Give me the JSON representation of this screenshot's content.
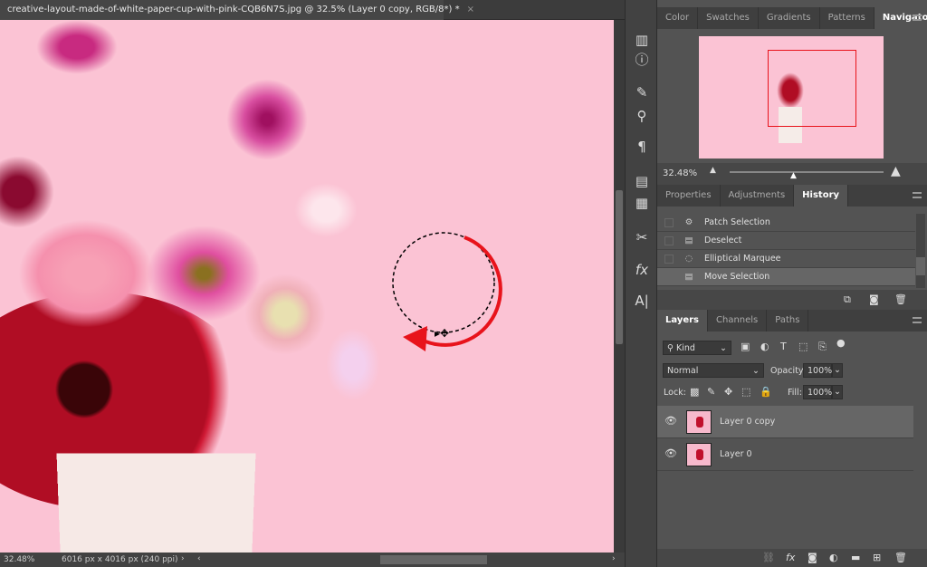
{
  "document": {
    "tab_title": "creative-layout-made-of-white-paper-cup-with-pink-CQB6N7S.jpg @ 32.5% (Layer 0 copy, RGB/8*) *",
    "close_icon": "×"
  },
  "status": {
    "zoom": "32.48%",
    "doc_info": "6016 px x 4016 px (240 ppi)",
    "arrow": "›",
    "scroll_left": "‹",
    "scroll_right": "›"
  },
  "toolstrip": [
    "history-icon",
    "info-icon",
    "brush-settings-icon",
    "clone-source-icon",
    "paragraph-icon",
    "character-styles-icon",
    "paragraph-styles-icon",
    "tool-presets-icon",
    "styles-icon",
    "glyphs-icon"
  ],
  "top_panel": {
    "tabs": [
      "Color",
      "Swatches",
      "Gradients",
      "Patterns",
      "Navigator"
    ],
    "active": "Navigator",
    "zoom": "32.48%"
  },
  "history_panel": {
    "tabs": [
      "Properties",
      "Adjustments",
      "History"
    ],
    "active": "History",
    "items": [
      {
        "label": "Patch Selection",
        "icon": "patch-icon"
      },
      {
        "label": "Deselect",
        "icon": "document-icon"
      },
      {
        "label": "Elliptical Marquee",
        "icon": "ellipse-icon"
      },
      {
        "label": "Move Selection",
        "icon": "document-icon",
        "selected": true
      }
    ]
  },
  "layers_panel": {
    "tabs": [
      "Layers",
      "Channels",
      "Paths"
    ],
    "active": "Layers",
    "filter": "Kind",
    "blend_mode": "Normal",
    "opacity_label": "Opacity:",
    "opacity": "100%",
    "lock_label": "Lock:",
    "fill_label": "Fill:",
    "fill": "100%",
    "layers": [
      {
        "name": "Layer 0 copy",
        "selected": true
      },
      {
        "name": "Layer 0",
        "selected": false
      }
    ]
  },
  "colors": {
    "canvas_bg": "#fbc3d4",
    "accent_red": "#e8131b",
    "panel_bg": "#535353"
  }
}
